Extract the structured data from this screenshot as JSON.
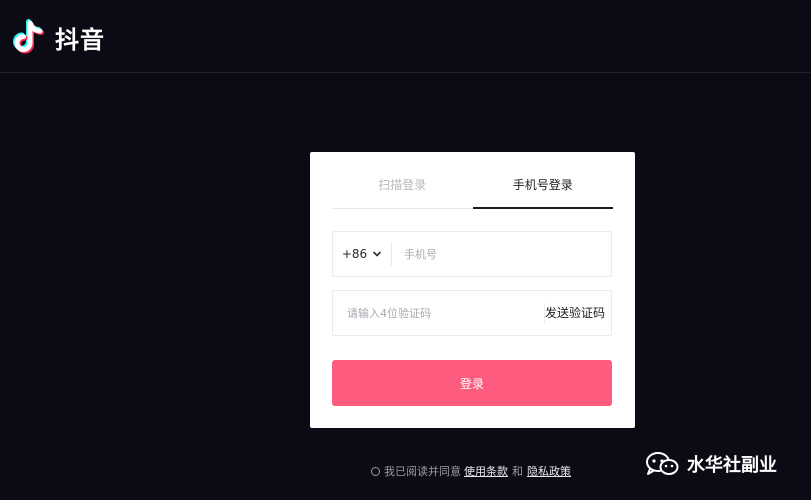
{
  "brand": {
    "name": "抖音"
  },
  "login": {
    "tabs": [
      {
        "label": "扫描登录",
        "active": false
      },
      {
        "label": "手机号登录",
        "active": true
      }
    ],
    "country_code": "+86",
    "phone_placeholder": "手机号",
    "code_placeholder": "请输入4位验证码",
    "send_code_label": "发送验证码",
    "submit_label": "登录"
  },
  "agreement": {
    "prefix": "我已阅读并同意",
    "terms_label": "使用条款",
    "conjunction": "和",
    "privacy_label": "隐私政策"
  },
  "watermark": {
    "text": "水华社副业",
    "icon": "wechat-icon"
  },
  "colors": {
    "background": "#0b0b16",
    "accent": "#fd5c7e",
    "tiktok_cyan": "#25f4ee",
    "tiktok_red": "#fe2c55"
  }
}
